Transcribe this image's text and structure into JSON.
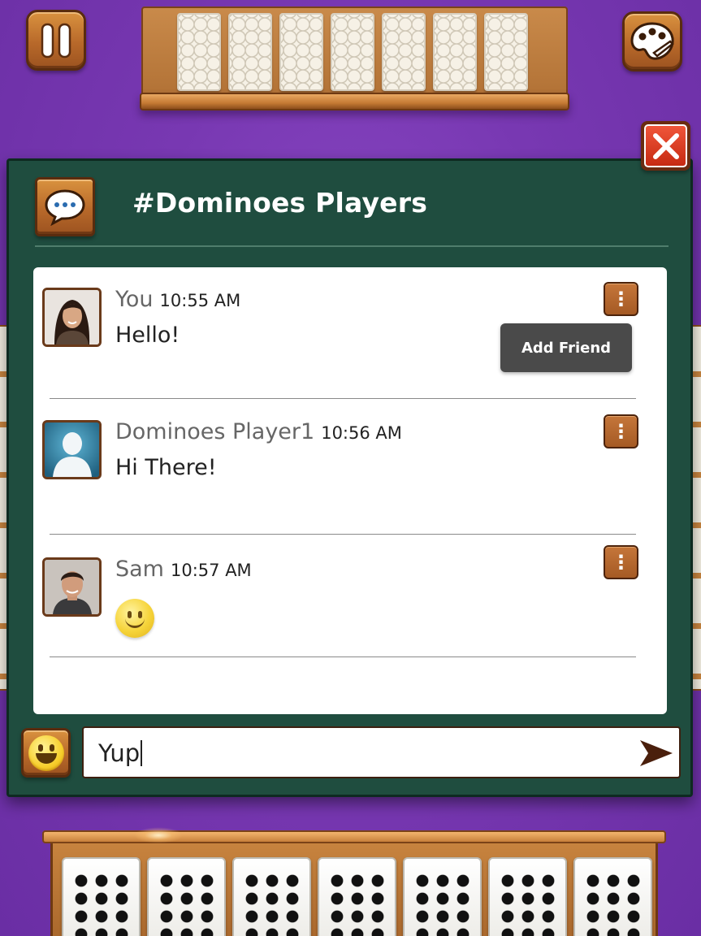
{
  "chat": {
    "title": "#Dominoes Players",
    "messages": [
      {
        "name": "You",
        "time": "10:55 AM",
        "text": "Hello!"
      },
      {
        "name": "Dominoes Player1",
        "time": "10:56 AM",
        "text": "Hi There!"
      },
      {
        "name": "Sam",
        "time": "10:57 AM",
        "text": ""
      }
    ],
    "tooltip": "Add Friend",
    "input_value": "Yup",
    "kebab_glyph": "⋮"
  },
  "icons": {
    "pause": "pause-icon",
    "theme": "palette-icon",
    "close": "close-icon",
    "chat": "speech-bubble-icon",
    "emoji": "emoji-icon",
    "send": "send-arrow-icon"
  },
  "colors": {
    "background": "#7838b2",
    "panel": "#1f4d3f",
    "wood": "#b8692a",
    "close_red": "#d9381e"
  }
}
